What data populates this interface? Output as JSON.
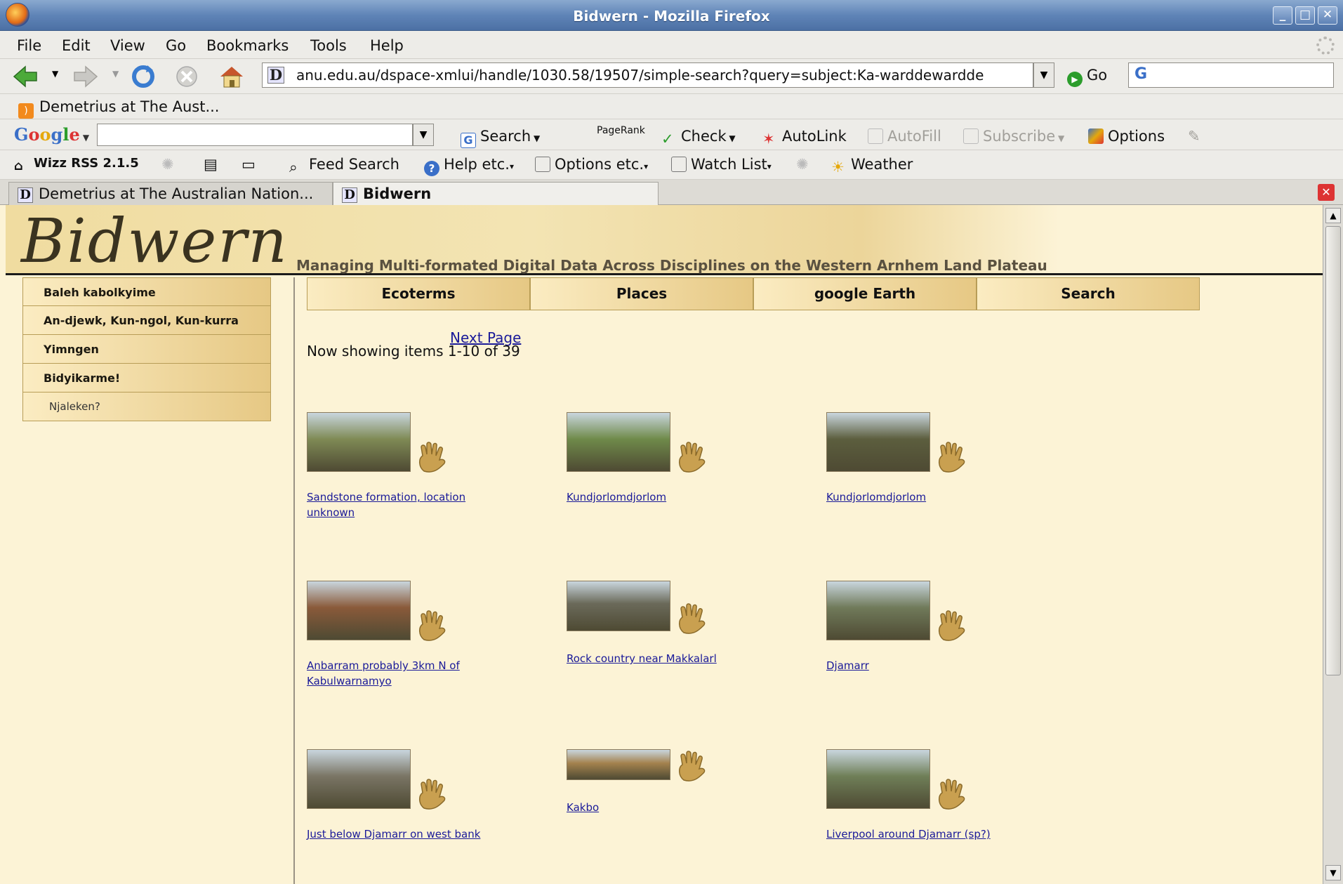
{
  "window": {
    "title": "Bidwern - Mozilla Firefox",
    "controls": [
      "_",
      "□",
      "✕"
    ]
  },
  "menu": [
    "File",
    "Edit",
    "View",
    "Go",
    "Bookmarks",
    "Tools",
    "Help"
  ],
  "nav": {
    "url": "anu.edu.au/dspace-xmlui/handle/1030.58/19507/simple-search?query=subject:Ka-warddewardde",
    "go_label": "Go"
  },
  "bookmarks": {
    "item": "Demetrius at The Aust..."
  },
  "google_toolbar": {
    "logo": "Google",
    "search": "Search",
    "pagerank": "PageRank",
    "check": "Check",
    "autolink": "AutoLink",
    "autofill": "AutoFill",
    "subscribe": "Subscribe",
    "options": "Options"
  },
  "wizz_toolbar": {
    "wizz": "Wizz RSS 2.1.5",
    "feed_search": "Feed Search",
    "help": "Help etc.",
    "options": "Options etc.",
    "watch_list": "Watch List",
    "weather": "Weather"
  },
  "tabs": [
    {
      "label": "Demetrius at The Australian Nation...",
      "active": false
    },
    {
      "label": "Bidwern",
      "active": true
    }
  ],
  "site": {
    "logo": "Bidwern",
    "tagline": "Managing Multi-formated Digital Data Across Disciplines on the Western Arnhem Land Plateau",
    "sidebar": [
      "Baleh kabolkyime",
      "An-djewk, Kun-ngol, Kun-kurra",
      "Yimngen",
      "Bidyikarme!",
      "Njaleken?"
    ],
    "topnav": [
      "Ecoterms",
      "Places",
      "google Earth",
      "Search"
    ],
    "next_page": "Next Page",
    "showing": "Now showing items 1-10 of 39"
  },
  "results": [
    {
      "caption": "Sandstone formation, location unknown",
      "tone": "#7f8a55"
    },
    {
      "caption": "Kundjorlomdjorlom",
      "tone": "#6f8a4a"
    },
    {
      "caption": "Kundjorlomdjorlom",
      "tone": "#5c5e3e"
    },
    {
      "caption": "Anbarram probably 3km N of Kabulwarnamyo",
      "tone": "#8a5a3a"
    },
    {
      "caption": "Rock country near Makkalarl",
      "tone": "#6b6a5a"
    },
    {
      "caption": "Djamarr",
      "tone": "#707a5a"
    },
    {
      "caption": "Just below Djamarr on west bank",
      "tone": "#7a7565"
    },
    {
      "caption": "Kakbo",
      "tone": "#a4824e"
    },
    {
      "caption": "Liverpool around Djamarr (sp?)",
      "tone": "#6f7f58"
    }
  ]
}
